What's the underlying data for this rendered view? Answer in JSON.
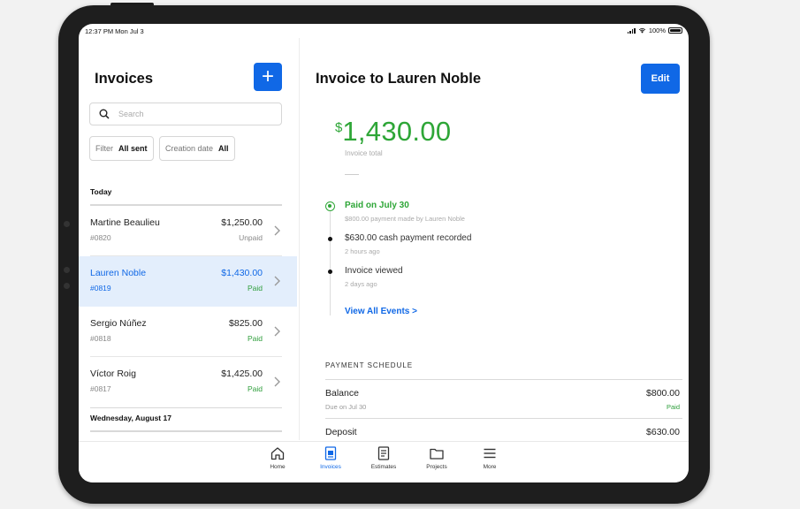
{
  "status_bar": {
    "time": "12:37 PM  Mon Jul 3",
    "battery": "100%"
  },
  "invoices_pane": {
    "title": "Invoices",
    "add_label": "+",
    "search_placeholder": "Search",
    "filters": [
      {
        "key": "Filter",
        "value": "All sent"
      },
      {
        "key": "Creation date",
        "value": "All"
      }
    ],
    "sections": [
      {
        "label": "Today",
        "rows": [
          {
            "name": "Martine Beaulieu",
            "number": "#0820",
            "amount": "$1,250.00",
            "status": "Unpaid",
            "selected": false
          },
          {
            "name": "Lauren Noble",
            "number": "#0819",
            "amount": "$1,430.00",
            "status": "Paid",
            "selected": true
          },
          {
            "name": "Sergio Núñez",
            "number": "#0818",
            "amount": "$825.00",
            "status": "Paid",
            "selected": false
          },
          {
            "name": "Víctor Roig",
            "number": "#0817",
            "amount": "$1,425.00",
            "status": "Paid",
            "selected": false
          }
        ]
      },
      {
        "label": "Wednesday, August 17",
        "rows": []
      }
    ]
  },
  "detail": {
    "title": "Invoice to Lauren Noble",
    "edit_label": "Edit",
    "total_currency": "$",
    "total_value": "1,430.00",
    "total_label": "Invoice total",
    "timeline": [
      {
        "title": "Paid on July 30",
        "sub": "$800.00 payment made by Lauren Noble"
      },
      {
        "title": "$630.00 cash payment recorded",
        "sub": "2 hours ago"
      },
      {
        "title": "Invoice viewed",
        "sub": "2 days ago"
      }
    ],
    "view_all_label": "View All Events >",
    "payment_schedule": {
      "label": "PAYMENT SCHEDULE",
      "rows": [
        {
          "name": "Balance",
          "sub": "Due on Jul 30",
          "amount": "$800.00",
          "status": "Paid"
        },
        {
          "name": "Deposit",
          "sub": "",
          "amount": "$630.00",
          "status": ""
        }
      ]
    }
  },
  "tabbar": {
    "tabs": [
      {
        "label": "Home",
        "icon": "home-icon",
        "active": false
      },
      {
        "label": "Invoices",
        "icon": "invoice-icon",
        "active": true
      },
      {
        "label": "Estimates",
        "icon": "estimate-icon",
        "active": false
      },
      {
        "label": "Projects",
        "icon": "folder-icon",
        "active": false
      },
      {
        "label": "More",
        "icon": "menu-icon",
        "active": false
      }
    ]
  },
  "colors": {
    "accent": "#1068e6",
    "paid_green": "#2ea637",
    "selected_row": "#e3eefc"
  }
}
